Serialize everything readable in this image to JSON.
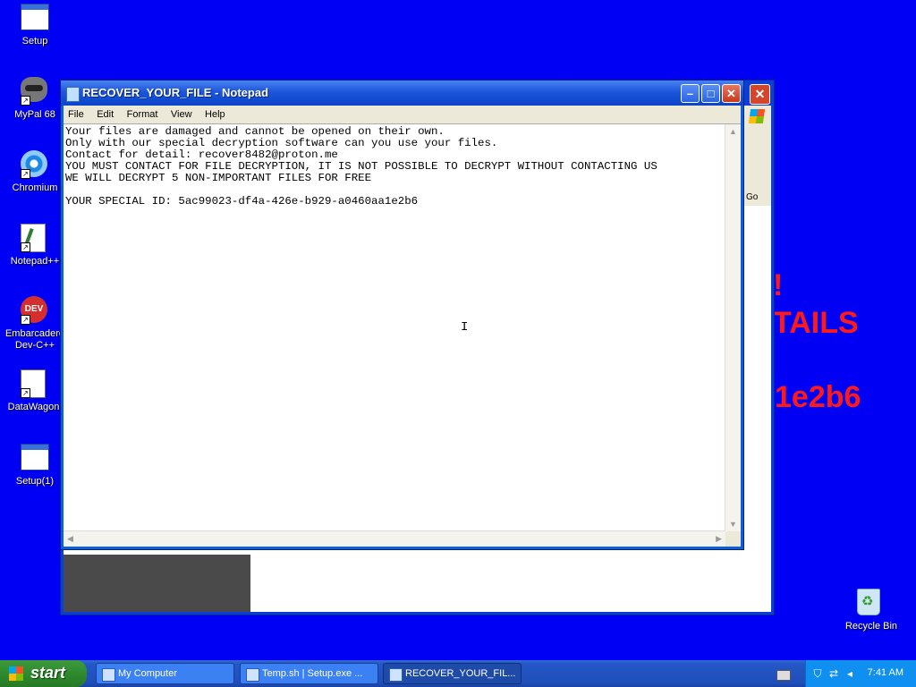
{
  "desktop": {
    "icons": [
      {
        "label": "Setup"
      },
      {
        "label": "MyPal 68"
      },
      {
        "label": "Chromium"
      },
      {
        "label": "Notepad++"
      },
      {
        "label_line1": "Embarcadero",
        "label_line2": "Dev-C++",
        "badge": "DEV"
      },
      {
        "label": "DataWagon."
      },
      {
        "label": "Setup(1)"
      },
      {
        "label": "Recycle Bin"
      }
    ],
    "background_text": [
      "!",
      "TAILS",
      "1e2b6"
    ]
  },
  "back_window": {
    "go_label": "Go"
  },
  "notepad": {
    "title": "RECOVER_YOUR_FILE - Notepad",
    "menu": [
      "File",
      "Edit",
      "Format",
      "View",
      "Help"
    ],
    "content": "Your files are damaged and cannot be opened on their own.\nOnly with our special decryption software can you use your files.\nContact for detail: recover8482@proton.me\nYOU MUST CONTACT FOR FILE DECRYPTION, IT IS NOT POSSIBLE TO DECRYPT WITHOUT CONTACTING US\nWE WILL DECRYPT 5 NON-IMPORTANT FILES FOR FREE\n\nYOUR SPECIAL ID: 5ac99023-df4a-426e-b929-a0460aa1e2b6"
  },
  "taskbar": {
    "start_label": "start",
    "tasks": [
      {
        "label": "My Computer",
        "active": false
      },
      {
        "label": "Temp.sh | Setup.exe ...",
        "active": false
      },
      {
        "label": "RECOVER_YOUR_FIL...",
        "active": true
      }
    ],
    "clock": "7:41 AM"
  },
  "colors": {
    "desktop_bg": "#0000f5",
    "ransom_red": "#ff1a1a"
  }
}
